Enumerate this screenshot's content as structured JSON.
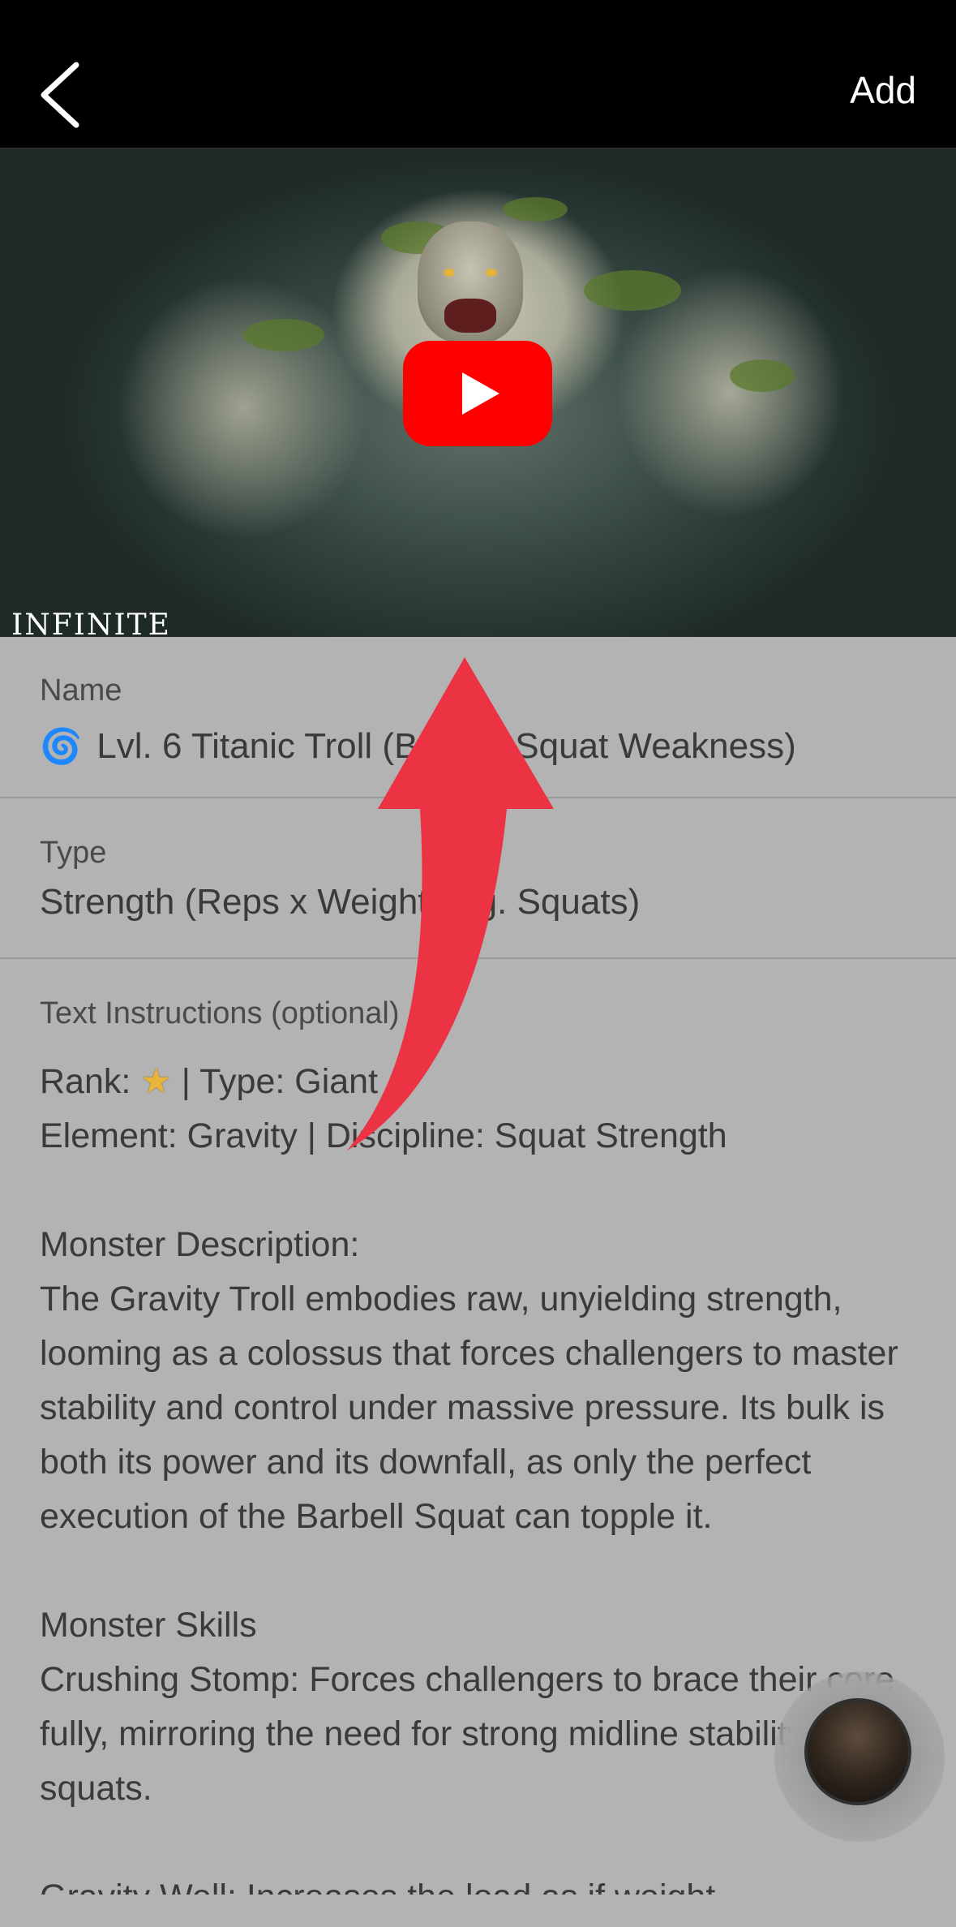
{
  "header": {
    "add_label": "Add"
  },
  "video": {
    "watermark": "INFINITE"
  },
  "name_field": {
    "label": "Name",
    "icon": "🌀",
    "value": "Lvl. 6 Titanic Troll (Barbell Squat Weakness)"
  },
  "type_field": {
    "label": "Type",
    "value": "Strength (Reps x Weight, e.g. Squats)"
  },
  "instructions": {
    "label": "Text Instructions (optional)",
    "rank_label": "Rank: ",
    "rank_icon": "★",
    "rank_type": " | Type: Giant",
    "element_line": "Element: Gravity | Discipline: Squat Strength",
    "description_title": "Monster Description:",
    "description": "The Gravity Troll embodies raw, unyielding strength, looming as a colossus that forces challengers to master stability and control under massive pressure. Its bulk is both its power and its downfall, as only the perfect execution of the Barbell Squat can topple it.",
    "skills_title": "Monster Skills",
    "skill_1": "Crushing Stomp: Forces challengers to brace their core fully, mirroring the need for strong midline stability during squats.",
    "skill_2_partial": "Gravity Well: Increases the load as if weight ..."
  },
  "colors": {
    "header_bg": "#000000",
    "overlay_bg": "#b3b3b3",
    "gesture_arrow": "#ec3344",
    "youtube_red": "#ff0000"
  },
  "icons": [
    "back-chevron-icon",
    "youtube-play-icon",
    "spiral-icon",
    "star-icon",
    "swipe-up-arrow-icon"
  ]
}
